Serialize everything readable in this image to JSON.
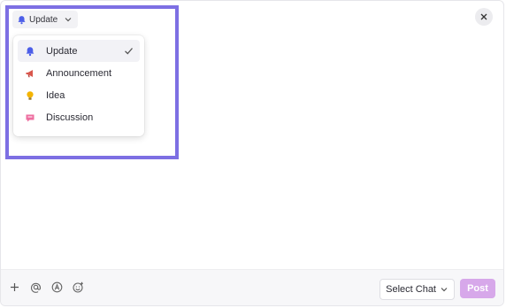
{
  "post_type_button": {
    "label": "Update",
    "icon": "bell-icon"
  },
  "type_menu": {
    "items": [
      {
        "label": "Update",
        "icon": "bell-icon",
        "icon_color": "#4c5ee8",
        "selected": true
      },
      {
        "label": "Announcement",
        "icon": "megaphone-icon",
        "icon_color": "#d9574d",
        "selected": false
      },
      {
        "label": "Idea",
        "icon": "lightbulb-icon",
        "icon_color": "#f4b400",
        "selected": false
      },
      {
        "label": "Discussion",
        "icon": "chat-bubble-icon",
        "icon_color": "#ee6fa0",
        "selected": false
      }
    ]
  },
  "footer": {
    "tools": [
      "plus-icon",
      "at-mention-icon",
      "assign-icon",
      "emoji-icon"
    ],
    "select_chat_label": "Select Chat",
    "post_label": "Post"
  },
  "colors": {
    "highlight": "#7d6fe3",
    "post_button": "#d7a8ea"
  }
}
